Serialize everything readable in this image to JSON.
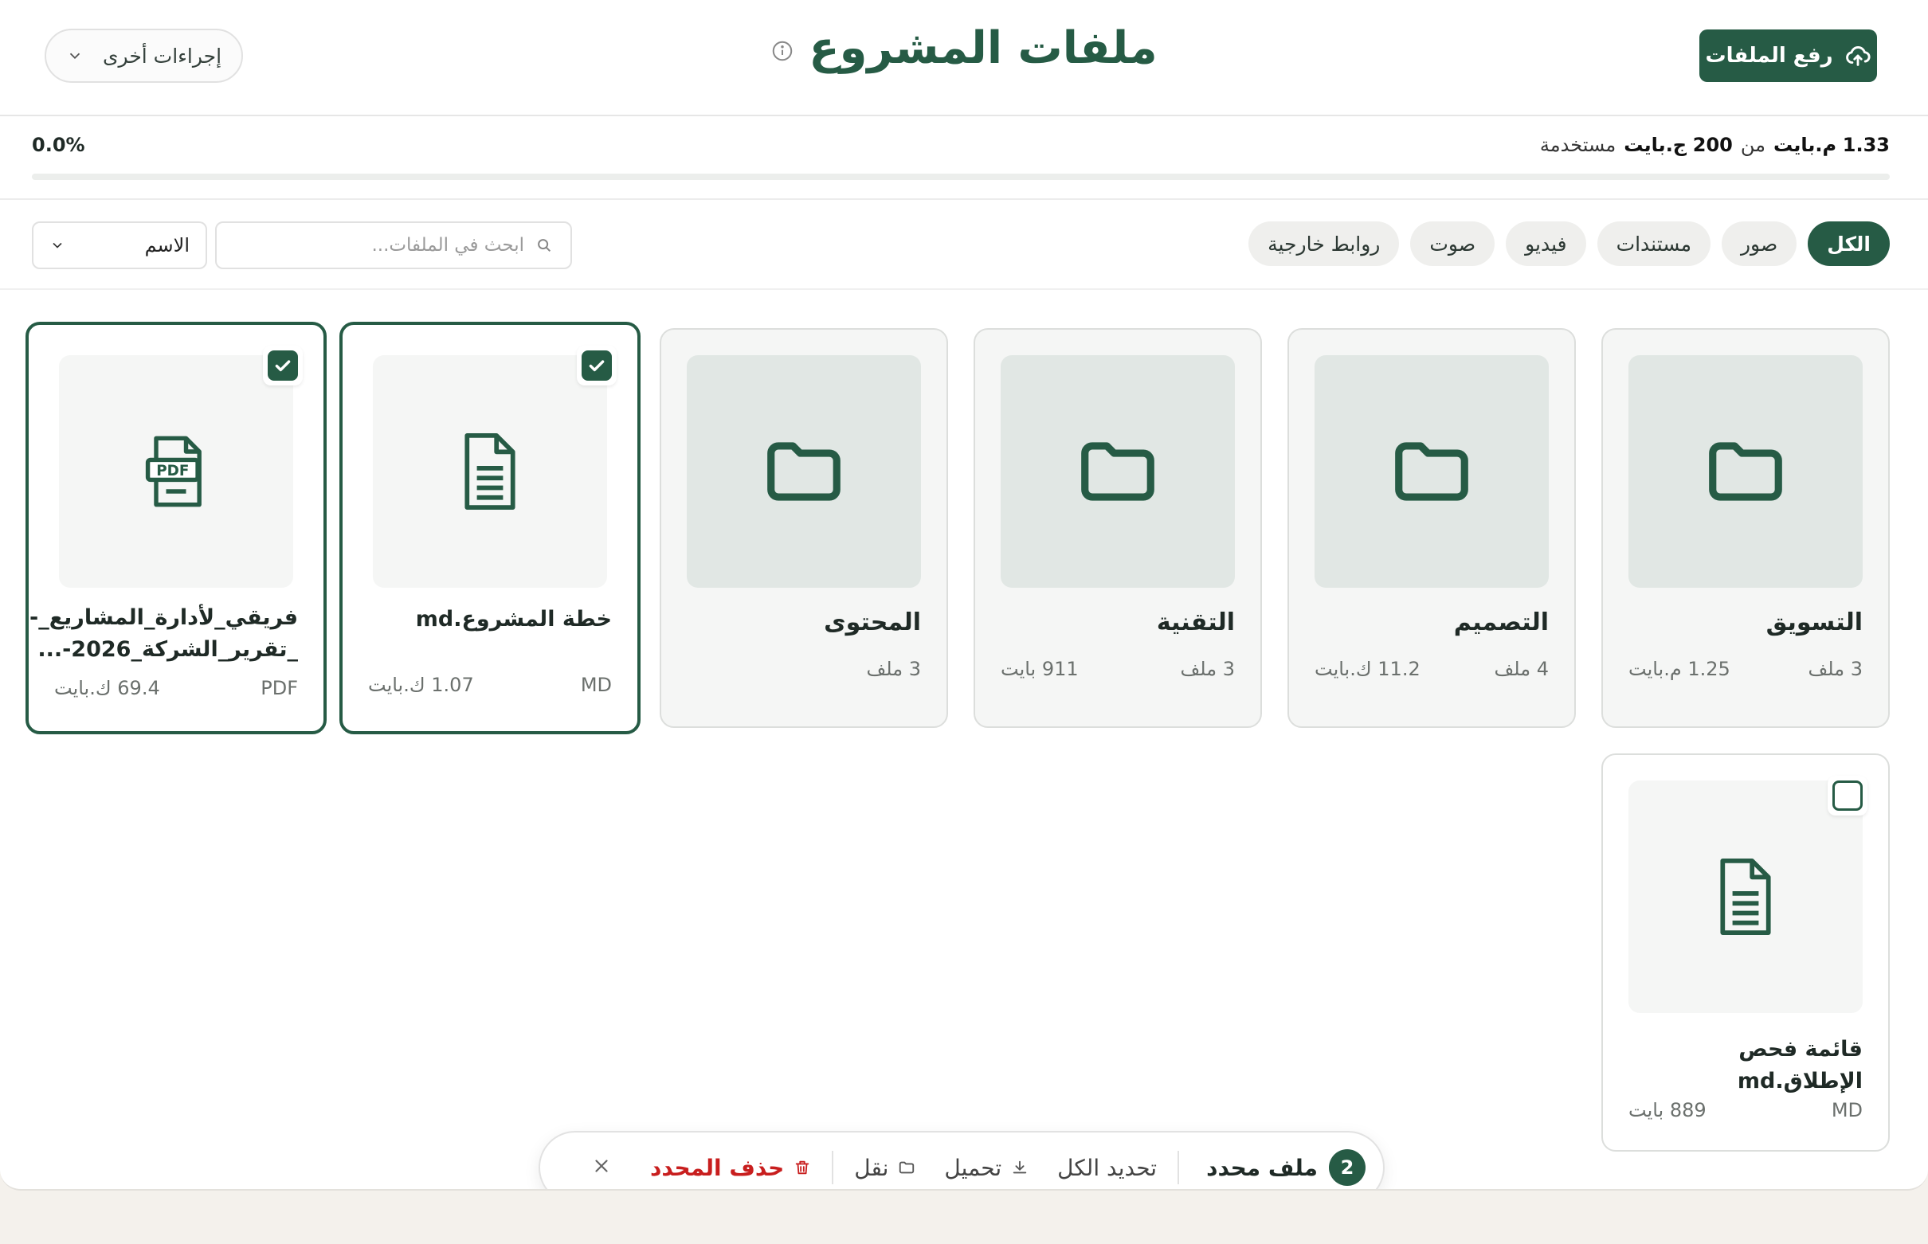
{
  "header": {
    "upload_label": "رفع الملفات",
    "title": "ملفات المشروع",
    "more_actions_label": "إجراءات أخرى"
  },
  "storage": {
    "used": "1.33",
    "used_unit": "م.بايت",
    "of": "من",
    "total": "200",
    "total_unit": "ج.بايت",
    "used_label": "مستخدمة",
    "percent_text": "0.0%",
    "fraction": 0.0
  },
  "filters": {
    "chips": [
      {
        "label": "الكل",
        "active": true
      },
      {
        "label": "صور"
      },
      {
        "label": "مستندات"
      },
      {
        "label": "فيديو"
      },
      {
        "label": "صوت"
      },
      {
        "label": "روابط خارجية"
      }
    ],
    "search_placeholder": "ابحث في الملفات...",
    "sort_label": "الاسم"
  },
  "folders": [
    {
      "name": "التسويق",
      "count": "3 ملف",
      "size": "1.25 م.بايت"
    },
    {
      "name": "التصميم",
      "count": "4 ملف",
      "size": "11.2 ك.بايت"
    },
    {
      "name": "التقنية",
      "count": "3 ملف",
      "size": "911 بايت"
    },
    {
      "name": "المحتوى",
      "count": "3 ملف",
      "size": ""
    }
  ],
  "files": [
    {
      "name": "خطة المشروع.md",
      "type": "MD",
      "size": "1.07 ك.بايت",
      "selected": true
    },
    {
      "name": "فريقي_لأدارة_المشاريع_-_تقرير_الشركة_2026-...",
      "type": "PDF",
      "size": "69.4 ك.بايت",
      "selected": true,
      "icon_text": "PDF"
    },
    {
      "name": "قائمة فحص الإطلاق.md",
      "type": "MD",
      "size": "889 بايت",
      "selected": false
    }
  ],
  "action_bar": {
    "count": "2",
    "selected_label": "ملف محدد",
    "select_all": "تحديد الكل",
    "download": "تحميل",
    "move": "نقل",
    "delete": "حذف المحدد"
  },
  "colors": {
    "brand": "#265b45",
    "danger": "#c81e1e"
  }
}
